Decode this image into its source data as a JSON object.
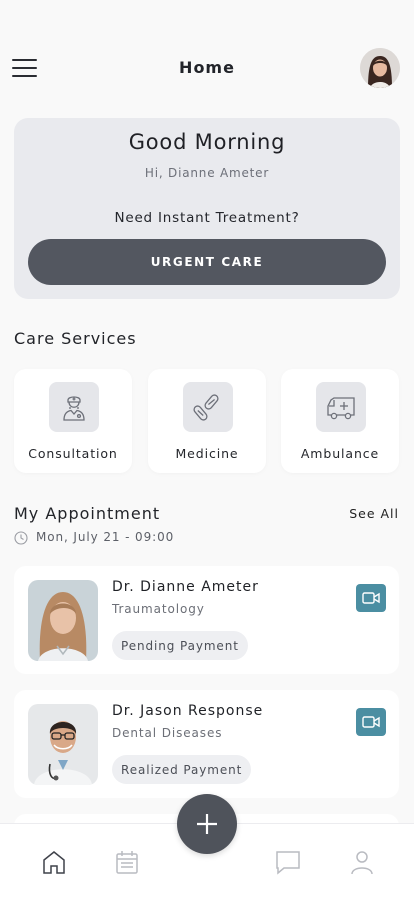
{
  "header": {
    "title": "Home"
  },
  "hero": {
    "greeting": "Good Morning",
    "subtitle": "Hi, Dianne Ameter",
    "question": "Need Instant Treatment?",
    "button_label": "URGENT CARE"
  },
  "services": {
    "title": "Care Services",
    "items": [
      {
        "label": "Consultation",
        "icon": "doctor-icon"
      },
      {
        "label": "Medicine",
        "icon": "pills-icon"
      },
      {
        "label": "Ambulance",
        "icon": "ambulance-icon"
      }
    ]
  },
  "appointments": {
    "title": "My Appointment",
    "see_all": "See All",
    "date": "Mon, July 21 - 09:00",
    "items": [
      {
        "name": "Dr. Dianne Ameter",
        "specialty": "Traumatology",
        "status": "Pending Payment"
      },
      {
        "name": "Dr. Jason Response",
        "specialty": "Dental Diseases",
        "status": "Realized Payment"
      }
    ]
  },
  "colors": {
    "accent": "#4b8ea2",
    "dark_button": "#535760",
    "card_bg": "#e9eaee"
  },
  "tabbar": {
    "items": [
      "home-icon",
      "calendar-icon",
      "add-icon",
      "chat-icon",
      "profile-icon"
    ]
  }
}
